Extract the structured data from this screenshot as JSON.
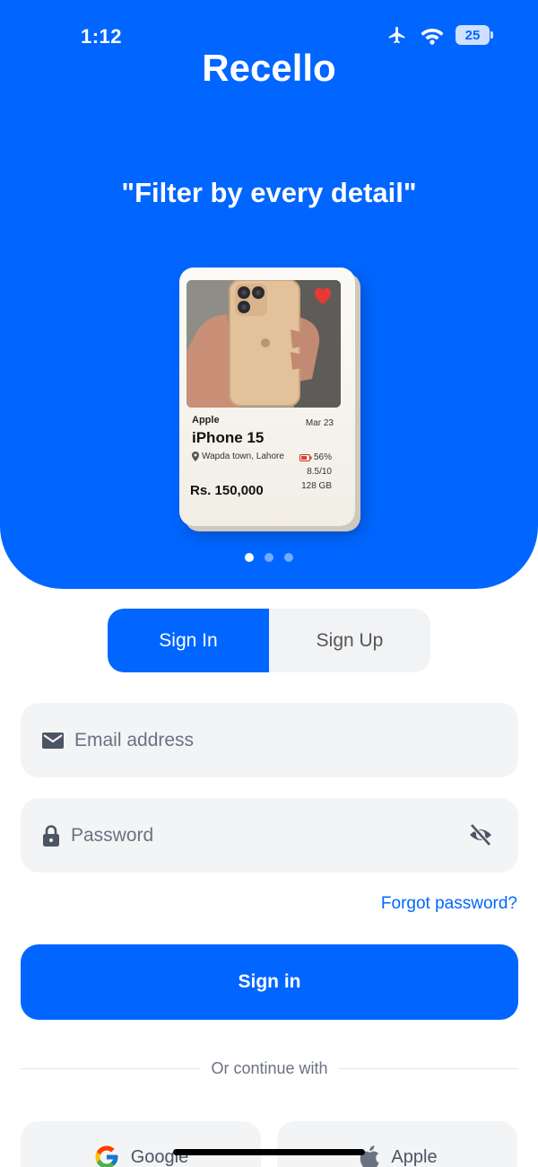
{
  "status_bar": {
    "time": "1:12",
    "battery": "25"
  },
  "hero": {
    "app_title": "Recello",
    "tagline": "\"Filter by every detail\"",
    "card": {
      "brand": "Apple",
      "model": "iPhone 15",
      "date": "Mar 23",
      "location": "Wapda town, Lahore",
      "battery_health": "56%",
      "condition": "8.5/10",
      "storage": "128 GB",
      "price": "Rs. 150,000"
    },
    "carousel": {
      "active_index": 0,
      "count": 3
    }
  },
  "auth_toggle": {
    "sign_in": "Sign In",
    "sign_up": "Sign Up",
    "active": "Sign In"
  },
  "form": {
    "email_placeholder": "Email address",
    "email_value": "",
    "password_placeholder": "Password",
    "password_value": "",
    "forgot_password": "Forgot password?",
    "submit": "Sign in"
  },
  "divider_text": "Or continue with",
  "social": {
    "google": "Google",
    "apple": "Apple"
  },
  "colors": {
    "brand": "#0066ff",
    "field_bg": "#f3f4f6",
    "heart": "#e53935"
  }
}
